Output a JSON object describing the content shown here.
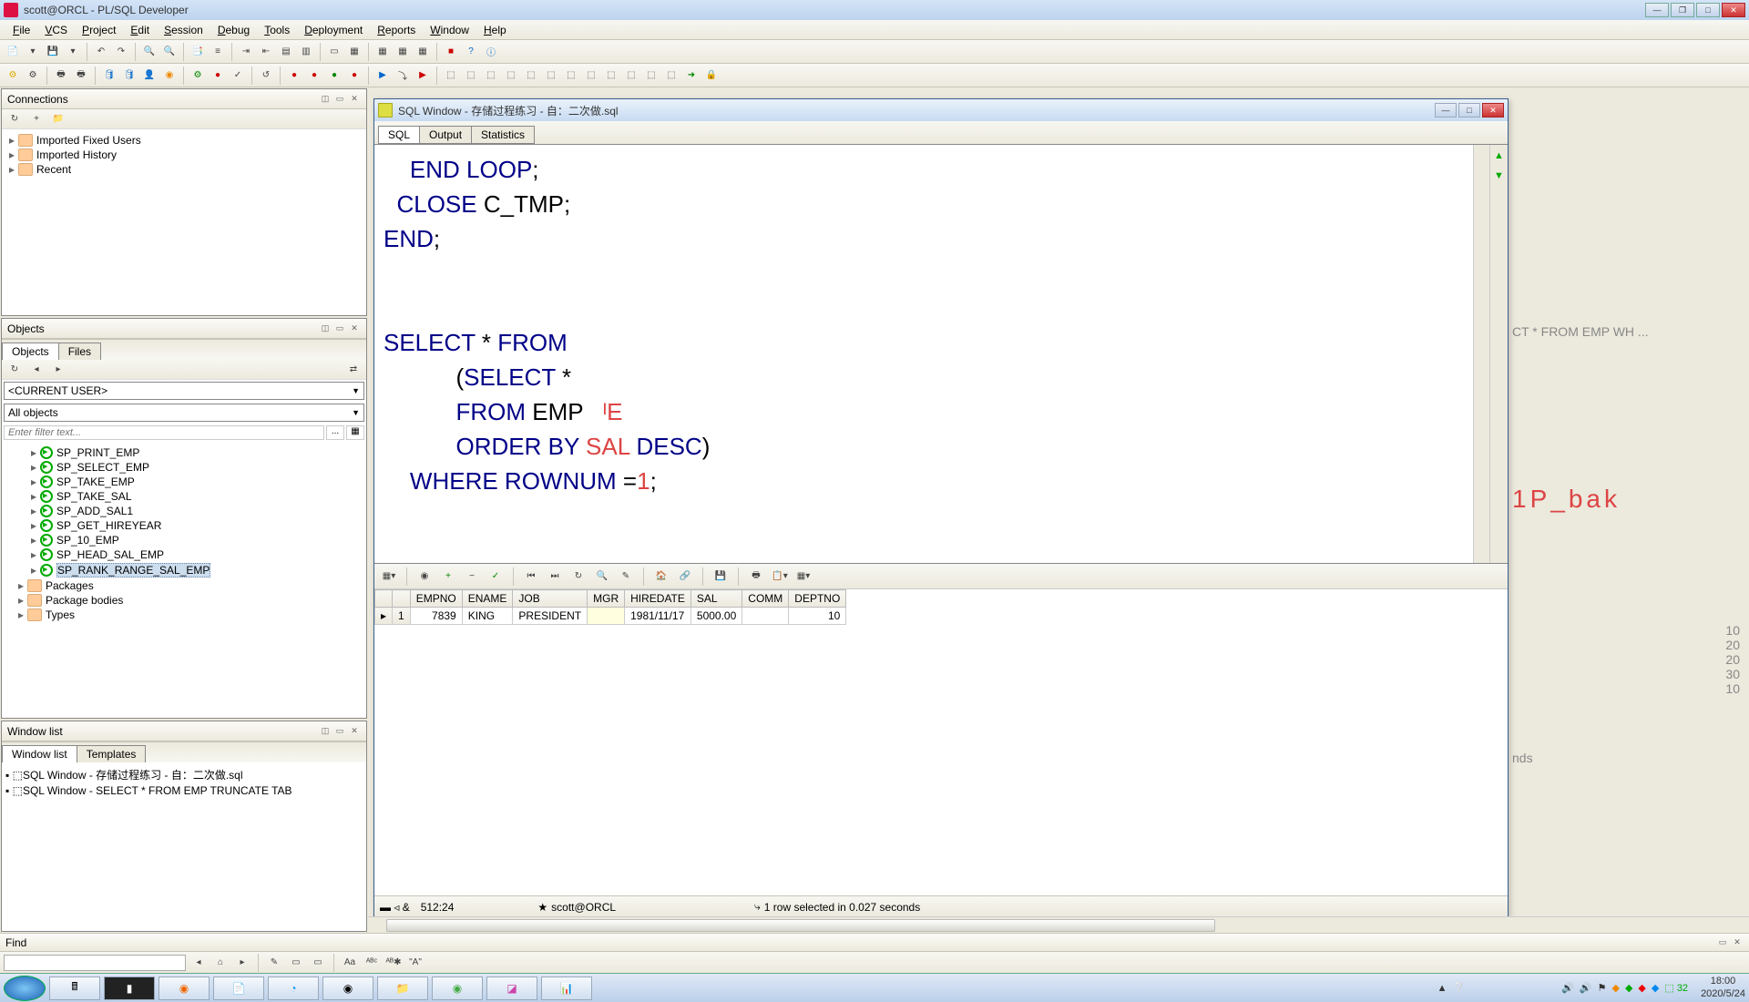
{
  "title": "scott@ORCL - PL/SQL Developer",
  "menu": [
    "File",
    "VCS",
    "Project",
    "Edit",
    "Session",
    "Debug",
    "Tools",
    "Deployment",
    "Reports",
    "Window",
    "Help"
  ],
  "panels": {
    "connections": {
      "title": "Connections",
      "items": [
        "Imported Fixed Users",
        "Imported History",
        "Recent"
      ]
    },
    "objects": {
      "title": "Objects",
      "tabs": [
        "Objects",
        "Files"
      ],
      "current_user": "<CURRENT USER>",
      "all_objects": "All objects",
      "filter_placeholder": "Enter filter text...",
      "list": [
        "SP_PRINT_EMP",
        "SP_SELECT_EMP",
        "SP_TAKE_EMP",
        "SP_TAKE_SAL",
        "SP_ADD_SAL1",
        "SP_GET_HIREYEAR",
        "SP_10_EMP",
        "SP_HEAD_SAL_EMP",
        "SP_RANK_RANGE_SAL_EMP"
      ],
      "selected_index": 8,
      "folders": [
        "Packages",
        "Package bodies",
        "Types"
      ]
    },
    "windowlist": {
      "title": "Window list",
      "tabs": [
        "Window list",
        "Templates"
      ],
      "items": [
        "SQL Window - 存储过程练习 - 自：二次做.sql",
        "SQL Window - SELECT * FROM EMP TRUNCATE TAB"
      ]
    }
  },
  "sqlwin": {
    "title": "SQL Window - 存储过程练习 - 自：二次做.sql",
    "tabs": [
      "SQL",
      "Output",
      "Statistics"
    ],
    "code_lines": [
      {
        "indent": 4,
        "tokens": [
          {
            "t": "END",
            "c": "kw"
          },
          {
            "t": " ",
            "c": "op"
          },
          {
            "t": "LOOP",
            "c": "kw"
          },
          {
            "t": ";",
            "c": "op"
          }
        ]
      },
      {
        "indent": 2,
        "tokens": [
          {
            "t": "CLOSE",
            "c": "kw"
          },
          {
            "t": " C_TMP;",
            "c": "op"
          }
        ]
      },
      {
        "indent": 0,
        "tokens": [
          {
            "t": "END",
            "c": "kw"
          },
          {
            "t": ";",
            "c": "op"
          }
        ]
      },
      {
        "indent": 0,
        "tokens": []
      },
      {
        "indent": 0,
        "tokens": []
      },
      {
        "indent": 0,
        "tokens": [
          {
            "t": "SELECT",
            "c": "kw"
          },
          {
            "t": " * ",
            "c": "op"
          },
          {
            "t": "FROM",
            "c": "kw"
          }
        ]
      },
      {
        "indent": 11,
        "tokens": [
          {
            "t": "(",
            "c": "op"
          },
          {
            "t": "SELECT",
            "c": "kw"
          },
          {
            "t": " *",
            "c": "op"
          }
        ]
      },
      {
        "indent": 11,
        "tokens": [
          {
            "t": "FROM",
            "c": "kw"
          },
          {
            "t": " EMP   ",
            "c": "op"
          },
          {
            "t": "ᴵE",
            "c": "ident"
          }
        ]
      },
      {
        "indent": 11,
        "tokens": [
          {
            "t": "ORDER",
            "c": "kw"
          },
          {
            "t": " ",
            "c": "op"
          },
          {
            "t": "BY",
            "c": "kw"
          },
          {
            "t": " SAL ",
            "c": "ident"
          },
          {
            "t": "DESC",
            "c": "kw"
          },
          {
            "t": ")",
            "c": "op"
          }
        ]
      },
      {
        "indent": 4,
        "tokens": [
          {
            "t": "WHERE",
            "c": "kw"
          },
          {
            "t": " ",
            "c": "op"
          },
          {
            "t": "ROWNUM",
            "c": "kw"
          },
          {
            "t": " =",
            "c": "op"
          },
          {
            "t": "1",
            "c": "ident"
          },
          {
            "t": ";",
            "c": "op"
          }
        ]
      }
    ],
    "grid": {
      "cols": [
        "EMPNO",
        "ENAME",
        "JOB",
        "MGR",
        "HIREDATE",
        "SAL",
        "COMM",
        "DEPTNO"
      ],
      "row": {
        "n": "1",
        "EMPNO": "7839",
        "ENAME": "KING",
        "JOB": "PRESIDENT",
        "MGR": "",
        "HIREDATE": "1981/11/17",
        "SAL": "5000.00",
        "COMM": "",
        "DEPTNO": "10"
      }
    },
    "status": {
      "pos": "512:24",
      "conn": "scott@ORCL",
      "msg": "1 row selected in 0.027 seconds"
    }
  },
  "find": {
    "title": "Find"
  },
  "bg_right": {
    "line1": "CT * FROM EMP WH ...",
    "line2": "1P_bak",
    "line3": "nds",
    "col": [
      "10",
      "20",
      "20",
      "30",
      "10"
    ]
  },
  "tray": {
    "time": "18:00",
    "date": "2020/5/24",
    "cpu": "32"
  }
}
